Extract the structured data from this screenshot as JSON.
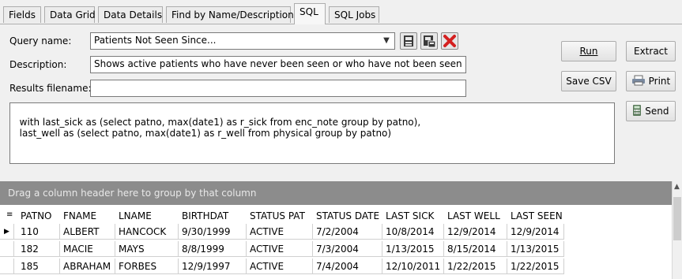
{
  "tabs": [
    {
      "label": "Fields",
      "active": false
    },
    {
      "label": "Data Grid",
      "active": false
    },
    {
      "label": "Data Details",
      "active": false
    },
    {
      "label": "Find by Name/Description",
      "active": false
    },
    {
      "label": "SQL",
      "active": true
    },
    {
      "label": "SQL Jobs",
      "active": false
    }
  ],
  "form": {
    "query_name_label": "Query name:",
    "query_name_value": "Patients Not Seen Since...",
    "description_label": "Description:",
    "description_value": "Shows active patients who have never been seen or who have not been seen sinc",
    "results_label": "Results filename:",
    "results_value": "",
    "sql_text": "with last_sick as (select patno, max(date1) as r_sick from enc_note group by patno),\n  last_well as (select patno, max(date1) as r_well from physical group by patno)"
  },
  "buttons": {
    "run": "Run",
    "extract": "Extract",
    "save_csv": "Save CSV",
    "print": "Print",
    "send": "Send"
  },
  "icons": {
    "save": "save-icon",
    "save_as": "save-as-icon",
    "delete": "delete-icon",
    "print": "printer-icon",
    "send": "calculator-icon",
    "grid_menu": "column-chooser-icon"
  },
  "grid": {
    "group_hint": "Drag a column header here to group by that column",
    "columns": [
      "PATNO",
      "FNAME",
      "LNAME",
      "BIRTHDAT",
      "STATUS PAT",
      "STATUS DATE",
      "LAST SICK",
      "LAST WELL",
      "LAST SEEN"
    ],
    "rows": [
      [
        "110",
        "ALBERT",
        "HANCOCK",
        "9/30/1999",
        "ACTIVE",
        "7/2/2004",
        "10/8/2014",
        "12/9/2014",
        "12/9/2014"
      ],
      [
        "182",
        "MACIE",
        "MAYS",
        "8/8/1999",
        "ACTIVE",
        "7/3/2004",
        "1/13/2015",
        "8/15/2014",
        "1/13/2015"
      ],
      [
        "185",
        "ABRAHAM",
        "FORBES",
        "12/9/1997",
        "ACTIVE",
        "7/4/2004",
        "12/10/2011",
        "1/22/2015",
        "1/22/2015"
      ]
    ]
  },
  "colors": {
    "delete_red": "#d42020",
    "group_bar": "#8c8c8c"
  }
}
